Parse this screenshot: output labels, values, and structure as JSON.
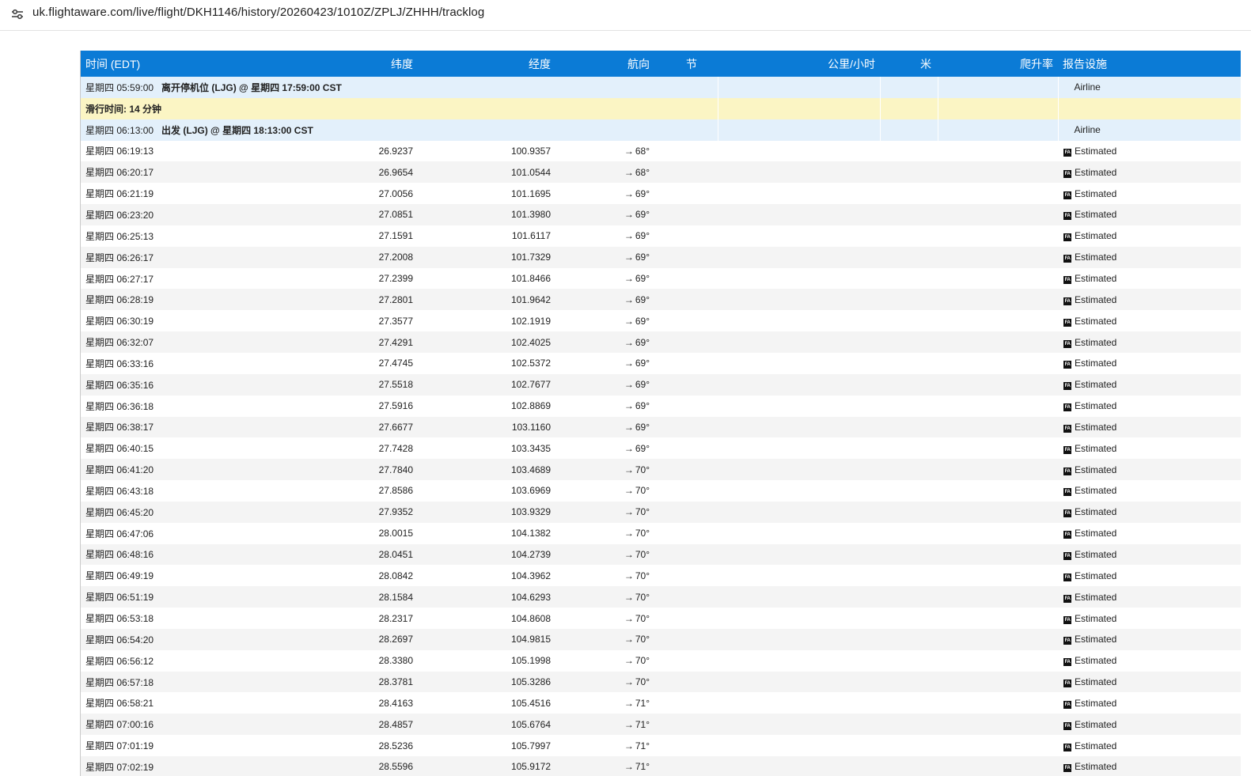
{
  "address_bar": {
    "url": "uk.flightaware.com/live/flight/DKH1146/history/20260423/1010Z/ZPLJ/ZHHH/tracklog",
    "icon": "site-settings-icon"
  },
  "table": {
    "headers": {
      "time": "时间 (EDT)",
      "lat": "纬度",
      "lon": "经度",
      "heading": "航向",
      "knots": "节",
      "kmh": "公里/小时",
      "meters": "米",
      "climb": "爬升率",
      "facility": "报告设施"
    },
    "events": [
      {
        "time": "星期四 05:59:00",
        "text": "离开停机位 (LJG) @ 星期四 17:59:00 CST",
        "facility": "Airline"
      },
      {
        "text": "滑行时间: 14 分钟"
      },
      {
        "time": "星期四 06:13:00",
        "text": "出发 (LJG) @ 星期四 18:13:00 CST",
        "facility": "Airline"
      }
    ],
    "fa_icon_text": "FA",
    "arrow_glyph": "→",
    "rows": [
      {
        "time": "星期四 06:19:13",
        "lat": "26.9237",
        "lon": "100.9357",
        "heading": "68°",
        "facility": "Estimated"
      },
      {
        "time": "星期四 06:20:17",
        "lat": "26.9654",
        "lon": "101.0544",
        "heading": "68°",
        "facility": "Estimated"
      },
      {
        "time": "星期四 06:21:19",
        "lat": "27.0056",
        "lon": "101.1695",
        "heading": "69°",
        "facility": "Estimated"
      },
      {
        "time": "星期四 06:23:20",
        "lat": "27.0851",
        "lon": "101.3980",
        "heading": "69°",
        "facility": "Estimated"
      },
      {
        "time": "星期四 06:25:13",
        "lat": "27.1591",
        "lon": "101.6117",
        "heading": "69°",
        "facility": "Estimated"
      },
      {
        "time": "星期四 06:26:17",
        "lat": "27.2008",
        "lon": "101.7329",
        "heading": "69°",
        "facility": "Estimated"
      },
      {
        "time": "星期四 06:27:17",
        "lat": "27.2399",
        "lon": "101.8466",
        "heading": "69°",
        "facility": "Estimated"
      },
      {
        "time": "星期四 06:28:19",
        "lat": "27.2801",
        "lon": "101.9642",
        "heading": "69°",
        "facility": "Estimated"
      },
      {
        "time": "星期四 06:30:19",
        "lat": "27.3577",
        "lon": "102.1919",
        "heading": "69°",
        "facility": "Estimated"
      },
      {
        "time": "星期四 06:32:07",
        "lat": "27.4291",
        "lon": "102.4025",
        "heading": "69°",
        "facility": "Estimated"
      },
      {
        "time": "星期四 06:33:16",
        "lat": "27.4745",
        "lon": "102.5372",
        "heading": "69°",
        "facility": "Estimated"
      },
      {
        "time": "星期四 06:35:16",
        "lat": "27.5518",
        "lon": "102.7677",
        "heading": "69°",
        "facility": "Estimated"
      },
      {
        "time": "星期四 06:36:18",
        "lat": "27.5916",
        "lon": "102.8869",
        "heading": "69°",
        "facility": "Estimated"
      },
      {
        "time": "星期四 06:38:17",
        "lat": "27.6677",
        "lon": "103.1160",
        "heading": "69°",
        "facility": "Estimated"
      },
      {
        "time": "星期四 06:40:15",
        "lat": "27.7428",
        "lon": "103.3435",
        "heading": "69°",
        "facility": "Estimated"
      },
      {
        "time": "星期四 06:41:20",
        "lat": "27.7840",
        "lon": "103.4689",
        "heading": "70°",
        "facility": "Estimated"
      },
      {
        "time": "星期四 06:43:18",
        "lat": "27.8586",
        "lon": "103.6969",
        "heading": "70°",
        "facility": "Estimated"
      },
      {
        "time": "星期四 06:45:20",
        "lat": "27.9352",
        "lon": "103.9329",
        "heading": "70°",
        "facility": "Estimated"
      },
      {
        "time": "星期四 06:47:06",
        "lat": "28.0015",
        "lon": "104.1382",
        "heading": "70°",
        "facility": "Estimated"
      },
      {
        "time": "星期四 06:48:16",
        "lat": "28.0451",
        "lon": "104.2739",
        "heading": "70°",
        "facility": "Estimated"
      },
      {
        "time": "星期四 06:49:19",
        "lat": "28.0842",
        "lon": "104.3962",
        "heading": "70°",
        "facility": "Estimated"
      },
      {
        "time": "星期四 06:51:19",
        "lat": "28.1584",
        "lon": "104.6293",
        "heading": "70°",
        "facility": "Estimated"
      },
      {
        "time": "星期四 06:53:18",
        "lat": "28.2317",
        "lon": "104.8608",
        "heading": "70°",
        "facility": "Estimated"
      },
      {
        "time": "星期四 06:54:20",
        "lat": "28.2697",
        "lon": "104.9815",
        "heading": "70°",
        "facility": "Estimated"
      },
      {
        "time": "星期四 06:56:12",
        "lat": "28.3380",
        "lon": "105.1998",
        "heading": "70°",
        "facility": "Estimated"
      },
      {
        "time": "星期四 06:57:18",
        "lat": "28.3781",
        "lon": "105.3286",
        "heading": "70°",
        "facility": "Estimated"
      },
      {
        "time": "星期四 06:58:21",
        "lat": "28.4163",
        "lon": "105.4516",
        "heading": "71°",
        "facility": "Estimated"
      },
      {
        "time": "星期四 07:00:16",
        "lat": "28.4857",
        "lon": "105.6764",
        "heading": "71°",
        "facility": "Estimated"
      },
      {
        "time": "星期四 07:01:19",
        "lat": "28.5236",
        "lon": "105.7997",
        "heading": "71°",
        "facility": "Estimated"
      },
      {
        "time": "星期四 07:02:19",
        "lat": "28.5596",
        "lon": "105.9172",
        "heading": "71°",
        "facility": "Estimated"
      }
    ]
  }
}
